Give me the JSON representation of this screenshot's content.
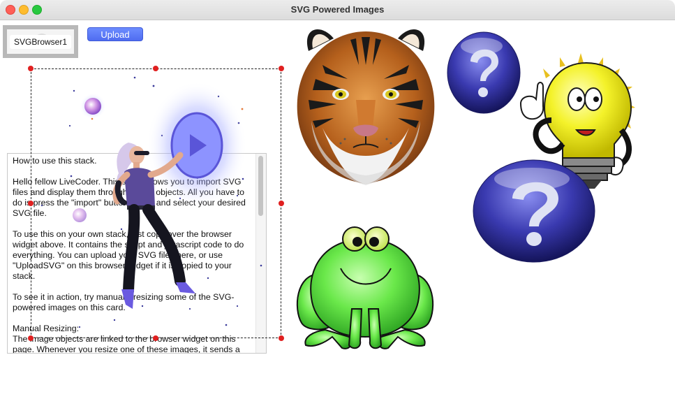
{
  "window": {
    "title": "SVG Powered Images"
  },
  "browser_widget": {
    "label": "SVGBrowser1"
  },
  "upload_button": {
    "label": "Upload"
  },
  "instructions": {
    "paragraphs": [
      "How to use this stack.",
      "Hello fellow LiveCoder. This stack allows you to import SVG files and display them through image objects. All you have to do is press the \"import\" button above and select your desired SVG file.",
      "To use this on your own stack, just copy over the browser widget above. It contains the script and javascript code to do everything. You can upload your SVG files here, or use \"UploadSVG\" on this browser widget if it is copied to your stack.",
      "To see it in action, try manually resizing some of the SVG-powered images on this card.",
      "Manual Resizing:\nThe image objects are linked to the browser widget on this page. Whenever you resize one of these images, it sends a"
    ]
  },
  "images": [
    {
      "name": "tiger"
    },
    {
      "name": "frog"
    },
    {
      "name": "question-ball-small"
    },
    {
      "name": "lightbulb"
    },
    {
      "name": "question-ball-large"
    },
    {
      "name": "dancer-with-play-button"
    }
  ],
  "colors": {
    "accent": "#5a78f5",
    "handle": "#e02020"
  }
}
